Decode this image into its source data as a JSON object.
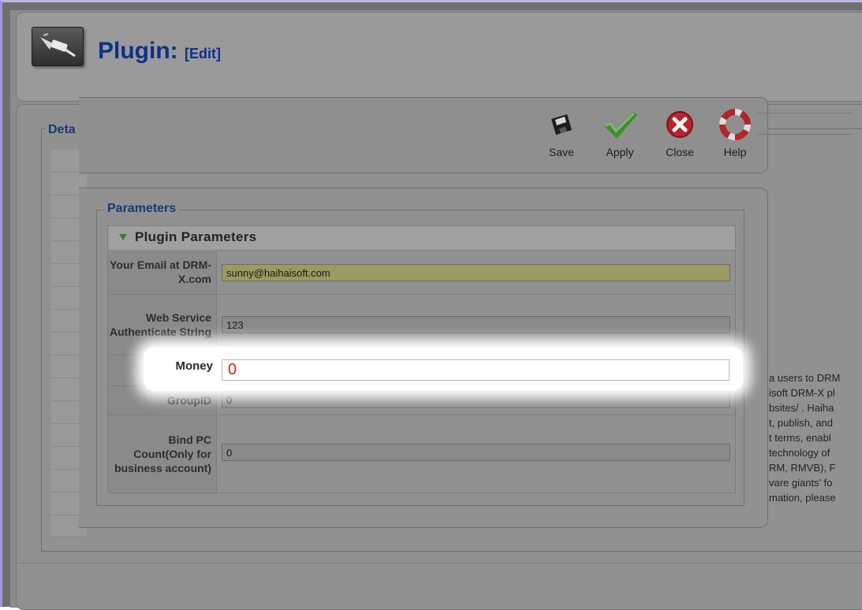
{
  "header": {
    "title": "Plugin:",
    "subtitle": "[Edit]"
  },
  "details": {
    "legend": "Deta"
  },
  "toolbar": {
    "save": "Save",
    "apply": "Apply",
    "close": "Close",
    "help": "Help"
  },
  "parameters": {
    "legend": "Parameters",
    "section_title": "Plugin Parameters",
    "email_label": "Your Email at DRM-X.com",
    "email_value": "sunny@haihaisoft.com",
    "auth_label": "Web Service Authenticate String",
    "auth_value": "123",
    "money_label": "Money",
    "money_value": "0",
    "group_label": "GroupID",
    "group_value": "0",
    "bindpc_label": "Bind PC Count(Only for business account)",
    "bindpc_value": "0"
  },
  "right_text": [
    "a users to DRM",
    "isoft DRM-X pl",
    "bsites/ . Haiha",
    "t, publish, and",
    "t terms, enabl",
    "technology of",
    "RM, RMVB), F",
    "vare giants' fo",
    "mation, please"
  ],
  "colors": {
    "title": "#0e2f8c",
    "money_text": "#e01b1b",
    "email_bg": "#9a9a62"
  }
}
